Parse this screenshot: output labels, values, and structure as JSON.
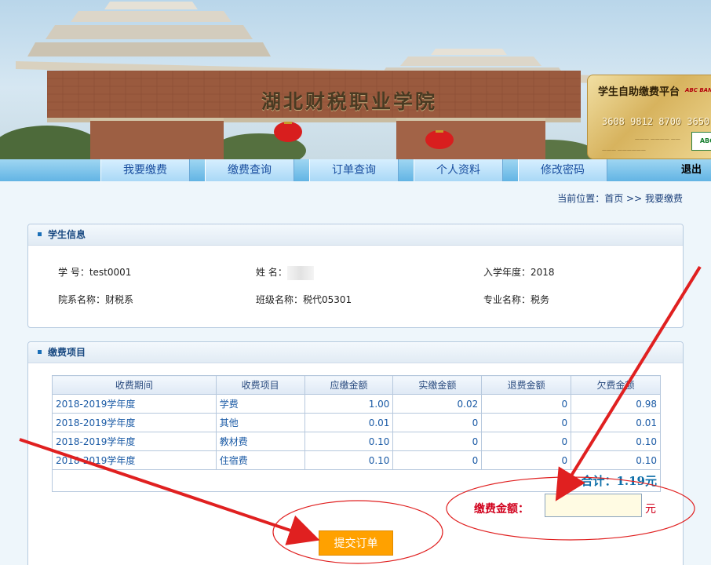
{
  "banner": {
    "gate_title": "湖北财税职业学院",
    "card": {
      "title": "学生自助缴费平台",
      "bank": "ABC BANK",
      "number": "3608 9812 8700 3650",
      "logo": "ABC"
    }
  },
  "nav": {
    "items": [
      {
        "label": "我要缴费"
      },
      {
        "label": "缴费查询"
      },
      {
        "label": "订单查询"
      },
      {
        "label": "个人资料"
      },
      {
        "label": "修改密码"
      }
    ],
    "logout": "退出"
  },
  "breadcrumb": {
    "prefix": "当前位置：",
    "home": "首页",
    "sep": " >> ",
    "current": "我要缴费"
  },
  "student": {
    "title": "学生信息",
    "id_label": "学 号：",
    "id_value": "test0001",
    "name_label": "姓 名：",
    "year_label": "入学年度：",
    "year_value": "2018",
    "dept_label": "院系名称：",
    "dept_value": "财税系",
    "class_label": "班级名称：",
    "class_value": "税代05301",
    "major_label": "专业名称：",
    "major_value": "税务"
  },
  "fees": {
    "title": "缴费项目",
    "headers": [
      "收费期间",
      "收费项目",
      "应缴金额",
      "实缴金额",
      "退费金额",
      "欠费金额"
    ],
    "rows": [
      {
        "period": "2018-2019学年度",
        "item": "学费",
        "due": "1.00",
        "paid": "0.02",
        "refund": "0",
        "owed": "0.98"
      },
      {
        "period": "2018-2019学年度",
        "item": "其他",
        "due": "0.01",
        "paid": "0",
        "refund": "0",
        "owed": "0.01"
      },
      {
        "period": "2018-2019学年度",
        "item": "教材费",
        "due": "0.10",
        "paid": "0",
        "refund": "0",
        "owed": "0.10"
      },
      {
        "period": "2018-2019学年度",
        "item": "住宿费",
        "due": "0.10",
        "paid": "0",
        "refund": "0",
        "owed": "0.10"
      }
    ],
    "total_label": "合计：",
    "total_value": "1.19元",
    "pay_label": "缴费金额：",
    "pay_value": "",
    "pay_unit": "元",
    "submit_label": "提交订单"
  },
  "colors": {
    "accent_red": "#d1001c",
    "button_orange": "#ffa100",
    "nav_blue": "#62b4e4",
    "annotation_red": "#e02020"
  }
}
